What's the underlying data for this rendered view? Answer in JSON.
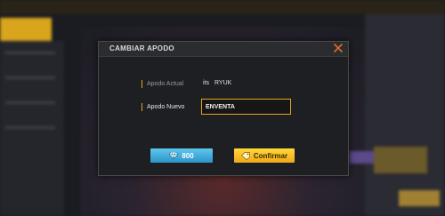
{
  "dialog": {
    "title": "CAMBIAR APODO",
    "close_icon": "close-icon"
  },
  "current_nickname": {
    "label": "Apodo Actual",
    "prefix": "its",
    "value": "RYUK"
  },
  "new_nickname": {
    "label": "Apodo Nuevo",
    "value": "ENVENTA"
  },
  "buttons": {
    "price_label": "800",
    "price_icon": "diamond-icon",
    "confirm_label": "Confirmar",
    "confirm_icon": "tag-icon"
  },
  "colors": {
    "accent": "#e5a41a",
    "price_button": "#3aa8d8",
    "confirm_button": "#f5c020",
    "close_icon": "#e06c2c"
  }
}
